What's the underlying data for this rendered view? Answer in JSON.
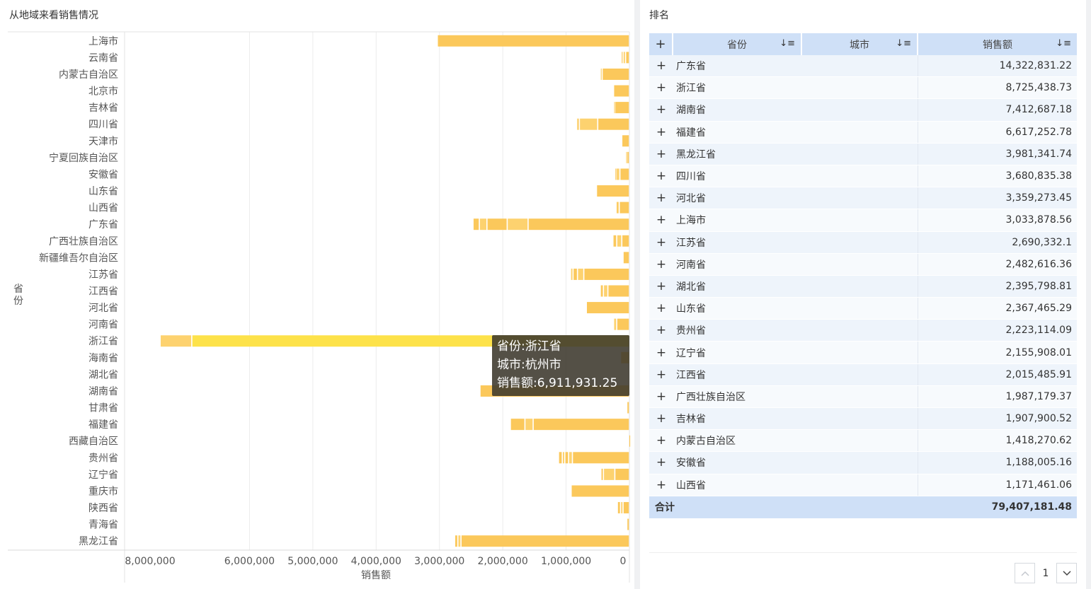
{
  "left_panel": {
    "title": "从地域来看销售情况"
  },
  "right_panel": {
    "title": "排名"
  },
  "tooltip": {
    "line1": "省份:浙江省",
    "line2": "城市:杭州市",
    "line3": "销售额:6,911,931.25"
  },
  "chart_data": {
    "type": "bar",
    "orientation": "horizontal",
    "stacked": true,
    "ylabel": "省份",
    "xlabel": "销售额",
    "x_axis_reversed": true,
    "xlim": [
      0,
      8000000
    ],
    "x_ticks": [
      {
        "value": 8000000,
        "label": "8,000,000"
      },
      {
        "value": 6000000,
        "label": "6,000,000"
      },
      {
        "value": 5000000,
        "label": "5,000,000"
      },
      {
        "value": 4000000,
        "label": "4,000,000"
      },
      {
        "value": 3000000,
        "label": "3,000,000"
      },
      {
        "value": 2000000,
        "label": "2,000,000"
      },
      {
        "value": 1000000,
        "label": "1,000,000"
      },
      {
        "value": 0,
        "label": "0"
      }
    ],
    "categories": [
      "上海市",
      "云南省",
      "内蒙古自治区",
      "北京市",
      "吉林省",
      "四川省",
      "天津市",
      "宁夏回族自治区",
      "安徽省",
      "山东省",
      "山西省",
      "广东省",
      "广西壮族自治区",
      "新疆维吾尔自治区",
      "江苏省",
      "江西省",
      "河北省",
      "河南省",
      "浙江省",
      "海南省",
      "湖北省",
      "湖南省",
      "甘肃省",
      "福建省",
      "西藏自治区",
      "贵州省",
      "辽宁省",
      "重庆市",
      "陕西省",
      "青海省",
      "黑龙江省"
    ],
    "segments": [
      [
        3033878.56
      ],
      [
        60000,
        40000,
        30000
      ],
      [
        430000,
        30000
      ],
      [
        250000
      ],
      [
        230000,
        20000
      ],
      [
        500000,
        290000,
        30000,
        15000
      ],
      [
        120000
      ],
      [
        40000,
        20000
      ],
      [
        150000,
        60000,
        20000
      ],
      [
        520000
      ],
      [
        160000,
        40000,
        10000
      ],
      [
        1600000,
        330000,
        320000,
        120000,
        100000
      ],
      [
        120000,
        80000,
        60000
      ],
      [
        100000
      ],
      [
        720000,
        100000,
        70000,
        40000
      ],
      [
        340000,
        70000,
        50000
      ],
      [
        680000
      ],
      [
        200000,
        50000
      ],
      [
        6911931.25,
        500000
      ],
      [
        140000
      ],
      [
        0
      ],
      [
        2360000
      ],
      [
        40000
      ],
      [
        1520000,
        130000,
        230000
      ],
      [
        10000
      ],
      [
        900000,
        60000,
        60000,
        40000,
        60000
      ],
      [
        230000,
        180000,
        40000
      ],
      [
        920000
      ],
      [
        100000,
        40000,
        50000
      ],
      [
        40000
      ],
      [
        2660000,
        50000,
        50000
      ]
    ],
    "colors": {
      "bar": "#fbc85b",
      "bar_light": "#fdd26f",
      "highlight": "#fde24a",
      "grid": "#ececec"
    }
  },
  "table": {
    "headers": {
      "province": "省份",
      "city": "城市",
      "sales": "销售额"
    },
    "rows": [
      {
        "province": "广东省",
        "sales": "14,322,831.22"
      },
      {
        "province": "浙江省",
        "sales": "8,725,438.73"
      },
      {
        "province": "湖南省",
        "sales": "7,412,687.18"
      },
      {
        "province": "福建省",
        "sales": "6,617,252.78"
      },
      {
        "province": "黑龙江省",
        "sales": "3,981,341.74"
      },
      {
        "province": "四川省",
        "sales": "3,680,835.38"
      },
      {
        "province": "河北省",
        "sales": "3,359,273.45"
      },
      {
        "province": "上海市",
        "sales": "3,033,878.56"
      },
      {
        "province": "江苏省",
        "sales": "2,690,332.1"
      },
      {
        "province": "河南省",
        "sales": "2,482,616.36"
      },
      {
        "province": "湖北省",
        "sales": "2,395,798.81"
      },
      {
        "province": "山东省",
        "sales": "2,367,465.29"
      },
      {
        "province": "贵州省",
        "sales": "2,223,114.09"
      },
      {
        "province": "辽宁省",
        "sales": "2,155,908.01"
      },
      {
        "province": "江西省",
        "sales": "2,015,485.91"
      },
      {
        "province": "广西壮族自治区",
        "sales": "1,987,179.37"
      },
      {
        "province": "吉林省",
        "sales": "1,907,900.52"
      },
      {
        "province": "内蒙古自治区",
        "sales": "1,418,270.62"
      },
      {
        "province": "安徽省",
        "sales": "1,188,005.16"
      },
      {
        "province": "山西省",
        "sales": "1,171,461.06"
      }
    ],
    "total": {
      "label": "合计",
      "value": "79,407,181.48"
    }
  },
  "pagination": {
    "page": "1"
  }
}
